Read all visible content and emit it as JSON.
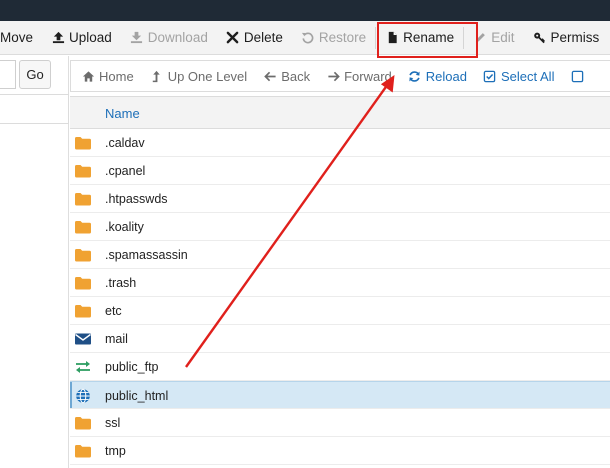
{
  "toolbar": {
    "items": [
      {
        "label": "Move",
        "icon": "move-icon",
        "disabled": false
      },
      {
        "label": "Upload",
        "icon": "upload-icon",
        "disabled": false
      },
      {
        "label": "Download",
        "icon": "download-icon",
        "disabled": true
      },
      {
        "label": "Delete",
        "icon": "delete-icon",
        "disabled": false
      },
      {
        "label": "Restore",
        "icon": "restore-icon",
        "disabled": true
      },
      {
        "label": "Rename",
        "icon": "file-icon",
        "disabled": false
      },
      {
        "label": "Edit",
        "icon": "pencil-icon",
        "disabled": true
      },
      {
        "label": "Permiss",
        "icon": "key-icon",
        "disabled": false
      }
    ]
  },
  "left": {
    "go_label": "Go"
  },
  "nav": {
    "home": "Home",
    "up": "Up One Level",
    "back": "Back",
    "forward": "Forward",
    "reload": "Reload",
    "select_all": "Select All"
  },
  "list": {
    "header": "Name",
    "rows": [
      {
        "name": ".caldav",
        "type": "folder"
      },
      {
        "name": ".cpanel",
        "type": "folder"
      },
      {
        "name": ".htpasswds",
        "type": "folder"
      },
      {
        "name": ".koality",
        "type": "folder"
      },
      {
        "name": ".spamassassin",
        "type": "folder"
      },
      {
        "name": ".trash",
        "type": "folder"
      },
      {
        "name": "etc",
        "type": "folder"
      },
      {
        "name": "mail",
        "type": "mail"
      },
      {
        "name": "public_ftp",
        "type": "ftp"
      },
      {
        "name": "public_html",
        "type": "globe",
        "selected": true
      },
      {
        "name": "ssl",
        "type": "folder"
      },
      {
        "name": "tmp",
        "type": "folder"
      }
    ]
  },
  "colors": {
    "annotation": "#e0201c",
    "folder": "#f0a232",
    "link_blue": "#1d6fb8",
    "selected_row": "#d5e8f5"
  }
}
